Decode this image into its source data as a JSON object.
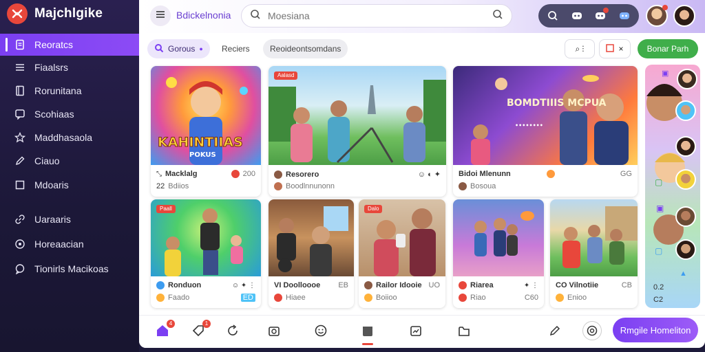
{
  "app": {
    "name": "Majchlgike"
  },
  "sidebar": {
    "items": [
      {
        "label": "Reoratcs",
        "icon": "file-icon",
        "active": true
      },
      {
        "label": "Fiaalsrs",
        "icon": "list-icon"
      },
      {
        "label": "Rorunitana",
        "icon": "book-icon"
      },
      {
        "label": "Scohiaas",
        "icon": "chat-icon"
      },
      {
        "label": "Maddhasaola",
        "icon": "star-icon"
      },
      {
        "label": "Ciauo",
        "icon": "pen-icon"
      },
      {
        "label": "Mdoaris",
        "icon": "square-icon"
      },
      {
        "label": "Uaraaris",
        "icon": "link-icon"
      },
      {
        "label": "Horeaacian",
        "icon": "globe-icon"
      },
      {
        "label": "Tionirls Macikoas",
        "icon": "message-icon"
      }
    ]
  },
  "topbar": {
    "breadcrumb": "Bdickelnonia",
    "search_placeholder": "Moesiana",
    "action_icons": [
      "search-icon",
      "discord-icon",
      "notification-icon",
      "discord-alt-icon"
    ]
  },
  "filters": {
    "primary": "Gorous",
    "chips": [
      "Reciers",
      "Reoideontsomdans"
    ],
    "view_btn_1": "⌕ ⫶",
    "view_btn_2": "×",
    "action": "Bonar Parh"
  },
  "cards": [
    {
      "thumb_title": "KAHINTIIAS",
      "thumb_sub": "POKUS",
      "title": "Macklalg",
      "sub": "Bdiios",
      "count": "200",
      "num": "22"
    },
    {
      "thumb_tag": "Aalasd",
      "title": "Resorero",
      "sub": "Boodlnnunonn"
    },
    {
      "thumb_title": "BOMDTIIIS MCPUA",
      "thumb_sub": "••••••••",
      "title": "Bidoi Mlenunn",
      "sub": "Bosoua",
      "count": "GG"
    },
    {
      "thumb_tag": "Paall",
      "title": "Ronduon",
      "sub": "Faado",
      "count": "ED"
    },
    {
      "title": "VI Doolloooe",
      "sub": "Hiaee",
      "count": "EB"
    },
    {
      "thumb_tag": "Dalo",
      "title": "Railor Idooie",
      "sub": "Boiioo",
      "count": "UO"
    },
    {
      "title": "Riarea",
      "sub": "Riao",
      "count": "C60"
    },
    {
      "title": "CO Vilnotiie",
      "sub": "Enioo",
      "count": "CB"
    }
  ],
  "strip": {
    "num_top": "0.2",
    "num_bottom": "C2"
  },
  "bottombar": {
    "badge_1": "4",
    "badge_2": "1",
    "create_label": "Rmgile Homeliton"
  },
  "colors": {
    "accent": "#7b3ff2",
    "sidebar": "#1c1838",
    "notify": "#e8473b",
    "green": "#3fae4a"
  }
}
